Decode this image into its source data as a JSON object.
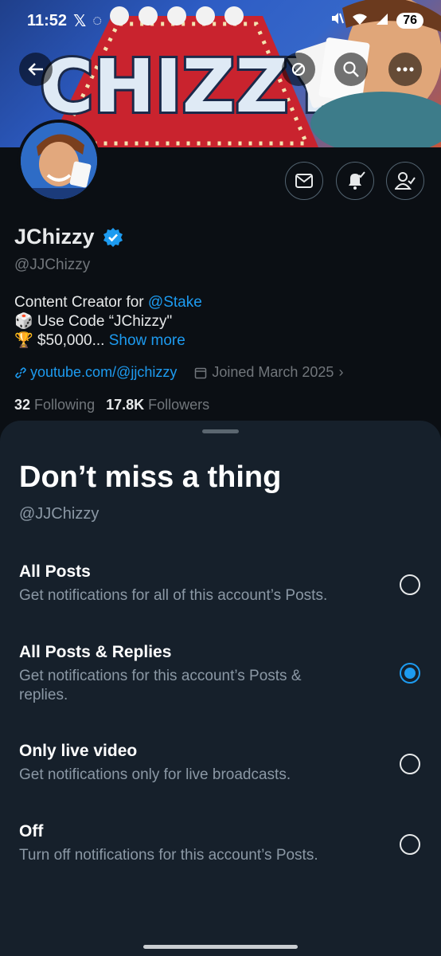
{
  "status_bar": {
    "time": "11:52",
    "left_icons": [
      "x-logo-icon",
      "whatsapp-icon"
    ],
    "right_icons": [
      "mute-icon",
      "wifi-icon",
      "signal-icon"
    ],
    "battery": "76"
  },
  "banner": {
    "text": "CHIZZY",
    "icons": [
      "back-arrow-icon",
      "refresh-icon",
      "search-icon",
      "more-icon"
    ]
  },
  "profile": {
    "display_name": "JChizzy",
    "handle": "@JJChizzy",
    "verified": true,
    "bio_prefix": "Content Creator for ",
    "bio_mention": "@Stake",
    "bio_line2": "🎲 Use Code “JChizzy\"",
    "bio_line3": "🏆 $50,000...",
    "show_more": "Show more",
    "website": "youtube.com/@jjchizzy",
    "joined": "Joined March 2025",
    "following_count": "32",
    "following_label": "Following",
    "followers_count": "17.8K",
    "followers_label": "Followers",
    "actions": [
      "message-icon",
      "notifications-icon",
      "follow-icon"
    ]
  },
  "sheet": {
    "title": "Don’t miss a thing",
    "handle": "@JJChizzy",
    "options": [
      {
        "title": "All Posts",
        "desc": "Get notifications for all of this account’s Posts.",
        "selected": false
      },
      {
        "title": "All Posts & Replies",
        "desc": "Get notifications for this account’s Posts & replies.",
        "selected": true
      },
      {
        "title": "Only live video",
        "desc": "Get notifications only for live broadcasts.",
        "selected": false
      },
      {
        "title": "Off",
        "desc": "Turn off notifications for this account’s Posts.",
        "selected": false
      }
    ]
  },
  "colors": {
    "background": "#0b0f14",
    "sheet": "#16202b",
    "accent": "#1d9bf0",
    "muted": "#8b98a5"
  }
}
